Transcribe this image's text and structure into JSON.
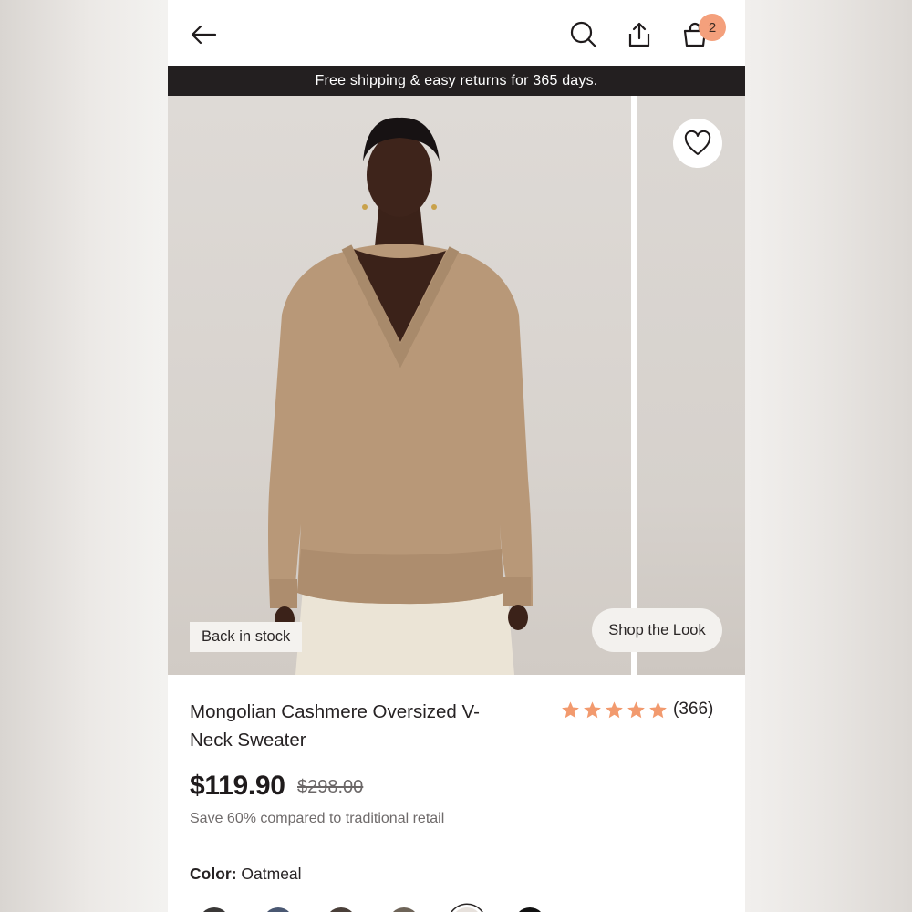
{
  "header": {
    "back_icon": "arrow-left-icon",
    "search_icon": "search-icon",
    "share_icon": "share-icon",
    "cart_icon": "bag-icon",
    "cart_count": "2"
  },
  "promo_banner": {
    "text": "Free shipping & easy returns for 365 days."
  },
  "gallery": {
    "favorite_icon": "heart-icon",
    "stock_badge": "Back in stock",
    "shop_the_look": "Shop the Look"
  },
  "product": {
    "title": "Mongolian Cashmere Oversized V-Neck Sweater",
    "rating": 5,
    "review_count": "(366)",
    "price": "$119.90",
    "original_price": "$298.00",
    "savings_note": "Save 60% compared to traditional retail",
    "color_label": "Color:",
    "color_value": "Oatmeal"
  },
  "colors": {
    "accent": "#f4a07c",
    "star": "#f29a6e",
    "banner_bg": "#231f20",
    "swatches": [
      "#3a3837",
      "#4a5872",
      "#4a3f39",
      "#6e6458",
      "#e7e1dc",
      "#111111"
    ]
  }
}
